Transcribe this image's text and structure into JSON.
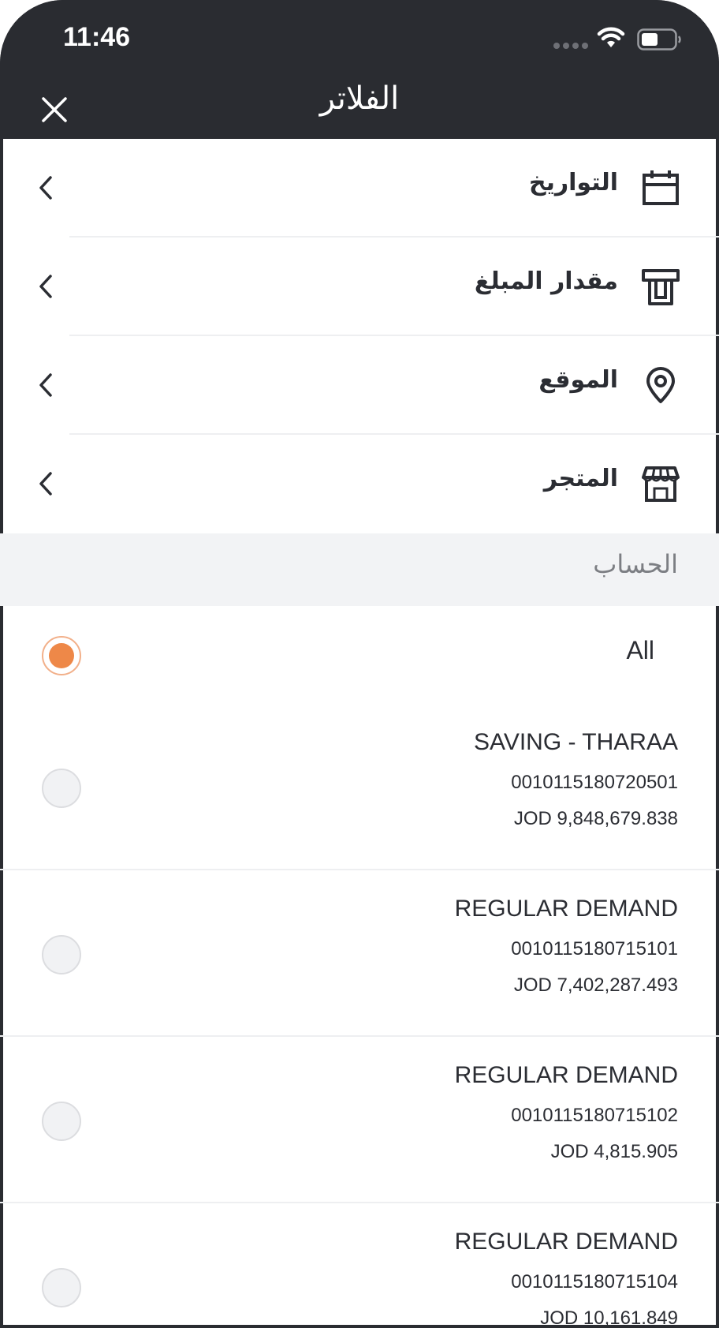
{
  "status_bar": {
    "time": "11:46"
  },
  "header": {
    "title": "الفلاتر",
    "close_icon": "close-icon"
  },
  "filters": [
    {
      "label": "التواريخ",
      "icon": "calendar-icon"
    },
    {
      "label": "مقدار المبلغ",
      "icon": "atm-icon"
    },
    {
      "label": "الموقع",
      "icon": "location-pin-icon"
    },
    {
      "label": "المتجر",
      "icon": "store-icon"
    }
  ],
  "account_section": {
    "title": "الحساب"
  },
  "accounts": {
    "all_label": "All",
    "all_selected": true,
    "items": [
      {
        "name": "SAVING - THARAA",
        "number": "0010115180720501",
        "balance": "JOD 9,848,679.838"
      },
      {
        "name": "REGULAR DEMAND",
        "number": "0010115180715101",
        "balance": "JOD 7,402,287.493"
      },
      {
        "name": "REGULAR DEMAND",
        "number": "0010115180715102",
        "balance": "JOD 4,815.905"
      },
      {
        "name": "REGULAR DEMAND",
        "number": "0010115180715104",
        "balance": "JOD 10,161.849"
      }
    ]
  },
  "colors": {
    "header_bg": "#2a2c31",
    "accent": "#ee8848",
    "section_bg": "#f2f3f5"
  }
}
